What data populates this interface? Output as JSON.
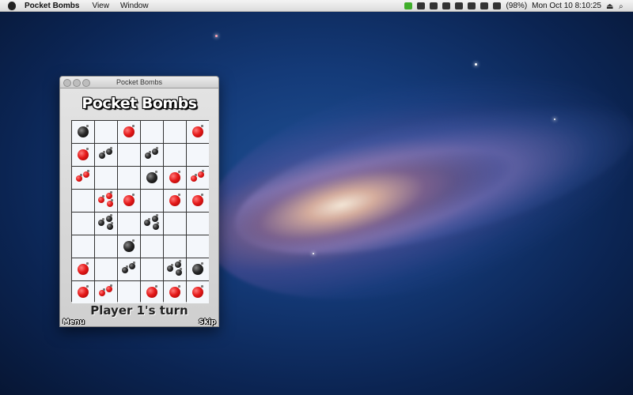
{
  "menubar": {
    "app_name": "Pocket Bombs",
    "items": [
      "View",
      "Window"
    ],
    "status": {
      "battery": "(98%)",
      "datetime": "Mon Oct 10  8:10:25"
    }
  },
  "window": {
    "title": "Pocket Bombs",
    "logo": "Pocket Bombs",
    "turn_text": "Player 1's turn",
    "menu_label": "Menu",
    "skip_label": "Skip"
  },
  "board": {
    "rows": 8,
    "cols": 6,
    "cells": [
      [
        [
          "black",
          1
        ],
        [
          null,
          0
        ],
        [
          "red",
          1
        ],
        [
          null,
          0
        ],
        [
          null,
          0
        ],
        [
          "red",
          1
        ]
      ],
      [
        [
          "red",
          1
        ],
        [
          "black",
          2
        ],
        [
          null,
          0
        ],
        [
          "black",
          2
        ],
        [
          null,
          0
        ],
        [
          null,
          0
        ]
      ],
      [
        [
          "red",
          2
        ],
        [
          null,
          0
        ],
        [
          null,
          0
        ],
        [
          "black",
          1
        ],
        [
          "red",
          1
        ],
        [
          "red",
          2
        ]
      ],
      [
        [
          null,
          0
        ],
        [
          "red",
          3
        ],
        [
          "red",
          1
        ],
        [
          null,
          0
        ],
        [
          "red",
          1
        ],
        [
          "red",
          1
        ]
      ],
      [
        [
          null,
          0
        ],
        [
          "black",
          3
        ],
        [
          null,
          0
        ],
        [
          "black",
          3
        ],
        [
          null,
          0
        ],
        [
          null,
          0
        ]
      ],
      [
        [
          null,
          0
        ],
        [
          null,
          0
        ],
        [
          "black",
          1
        ],
        [
          null,
          0
        ],
        [
          null,
          0
        ],
        [
          null,
          0
        ]
      ],
      [
        [
          "red",
          1
        ],
        [
          null,
          0
        ],
        [
          "black",
          2
        ],
        [
          null,
          0
        ],
        [
          "black",
          3
        ],
        [
          "black",
          1
        ]
      ],
      [
        [
          "red",
          1
        ],
        [
          "red",
          2
        ],
        [
          null,
          0
        ],
        [
          "red",
          1
        ],
        [
          "red",
          1
        ],
        [
          "red",
          1
        ]
      ]
    ]
  }
}
